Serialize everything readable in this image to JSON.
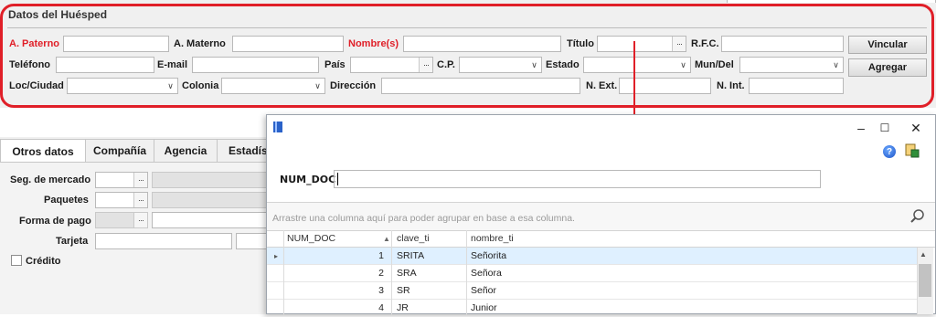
{
  "guest": {
    "title": "Datos del Huésped",
    "paterno_label": "A. Paterno",
    "materno_label": "A. Materno",
    "nombres_label": "Nombre(s)",
    "titulo_label": "Título",
    "rfc_label": "R.F.C.",
    "vincular_button": "Vincular",
    "telefono_label": "Teléfono",
    "email_label": "E-mail",
    "pais_label": "País",
    "cp_label": "C.P.",
    "estado_label": "Estado",
    "mundel_label": "Mun/Del",
    "agregar_button": "Agregar",
    "loc_label": "Loc/Ciudad",
    "colonia_label": "Colonia",
    "direccion_label": "Dirección",
    "next_label": "N. Ext.",
    "nint_label": "N. Int."
  },
  "tabs": [
    "Otros datos",
    "Compañía",
    "Agencia",
    "Estadís"
  ],
  "otros": {
    "seg_label": "Seg. de mercado",
    "paquetes_label": "Paquetes",
    "forma_pago_label": "Forma de pago",
    "tarjeta_label": "Tarjeta",
    "credito_label": "Crédito"
  },
  "dialog": {
    "window_controls": {
      "minimize": "–",
      "maximize": "☐",
      "close": "✕"
    },
    "help_glyph": "?",
    "filter_label": "NUM_DOC",
    "filter_value": "",
    "group_hint": "Arrastre una columna aquí para poder agrupar en base a esa columna.",
    "columns": [
      "NUM_DOC",
      "clave_ti",
      "nombre_ti"
    ],
    "sort_indicator": "▲",
    "rows": [
      {
        "num": "1",
        "clave": "SRITA",
        "nombre": "Señorita"
      },
      {
        "num": "2",
        "clave": "SRA",
        "nombre": "Señora"
      },
      {
        "num": "3",
        "clave": "SR",
        "nombre": "Señor"
      },
      {
        "num": "4",
        "clave": "JR",
        "nombre": "Junior"
      }
    ]
  },
  "icons": {
    "dots": "···",
    "chevron_down": "∨",
    "row_pointer": "▸",
    "scroll_up": "▲"
  },
  "colors": {
    "highlight": "#e01f28",
    "required_label": "#e01f28"
  }
}
